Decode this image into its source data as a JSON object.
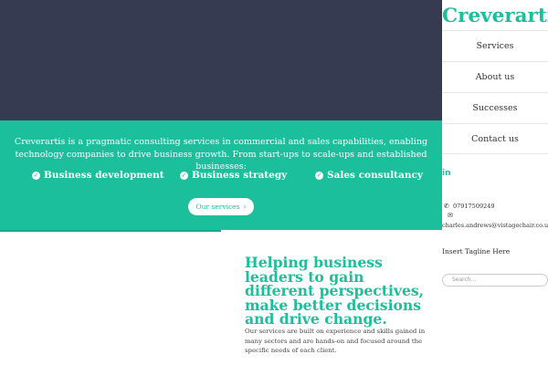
{
  "hero": {
    "intro": "Creverartis is a pragmatic consulting services in commercial and sales capabilities, enabling technology companies to drive business growth. From start-ups to scale-ups and established businesses:",
    "features": [
      "Business development",
      "Business strategy",
      "Sales consultancy"
    ],
    "services_button": "Our services"
  },
  "content": {
    "headline": "Helping business leaders to gain different perspectives, make better decisions and drive change.",
    "paragraph": "Our services are built on experience and skills gained in many sectors and are hands-on and focused around the specific needs of each client."
  },
  "sidebar": {
    "brand": "Creverartis.",
    "nav": [
      "Services",
      "About us",
      "Successes",
      "Contact us"
    ],
    "linkedin_label": "in",
    "phone": "07917509249",
    "email": "charles.andrews@vistagechair.co.uk",
    "tagline": "Insert Tagline Here",
    "search_placeholder": "Search..."
  },
  "colors": {
    "hero_dark": "#363b51",
    "accent": "#1cbf9c",
    "text": "#333333"
  },
  "icons": [
    "check-circle-icon",
    "chevron-right-icon",
    "linkedin-icon",
    "phone-icon",
    "envelope-icon"
  ]
}
